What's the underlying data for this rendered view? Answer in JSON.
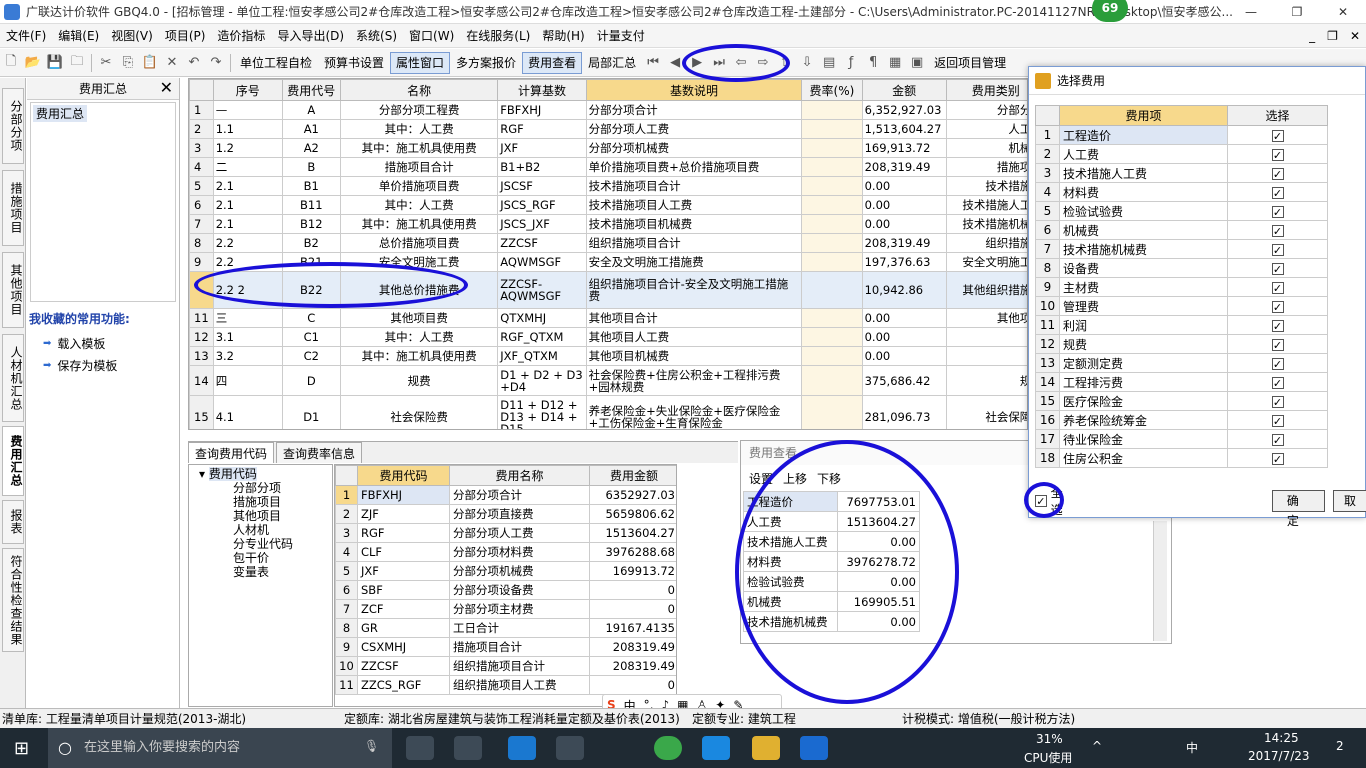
{
  "title_bar": {
    "text": "广联达计价软件 GBQ4.0 - [招标管理 - 单位工程:恒安孝感公司2#仓库改造工程>恒安孝感公司2#仓库改造工程>恒安孝感公司2#仓库改造工程-土建部分 - C:\\Users\\Administrator.PC-20141127NRH\\Desktop\\恒安孝感公...",
    "badge": "69",
    "minimize": "—",
    "maximize": "❐",
    "close": "✕"
  },
  "menu": [
    "文件(F)",
    "编辑(E)",
    "视图(V)",
    "项目(P)",
    "造价指标",
    "导入导出(D)",
    "系统(S)",
    "窗口(W)",
    "在线服务(L)",
    "帮助(H)",
    "计量支付"
  ],
  "menu_right": [
    "_",
    "❐",
    "✕"
  ],
  "toolbar": {
    "self_check": "单位工程自检",
    "budget_setting": "预算书设置",
    "property_window": "属性窗口",
    "multi_quote": "多方案报价",
    "fee_view": "费用查看",
    "partial_summary": "局部汇总",
    "back_project": "返回项目管理"
  },
  "left_tabs": [
    "分部分项",
    "措施项目",
    "其他项目",
    "人材机汇总",
    "费用汇总",
    "报表",
    "符合性检查结果"
  ],
  "side_panel": {
    "title": "费用汇总",
    "close": "✕",
    "tree_node": "费用汇总",
    "fav_title": "我收藏的常用功能:",
    "fav_items": [
      "载入模板",
      "保存为模板"
    ]
  },
  "grid": {
    "headers": [
      "",
      "序号",
      "费用代号",
      "名称",
      "计算基数",
      "基数说明",
      "费率(%)",
      "金额",
      "费用类别",
      "不可"
    ],
    "rows": [
      [
        "1",
        "⊟",
        "—",
        "A",
        "分部分项工程费",
        "FBFXHJ",
        "分部分项合计",
        "",
        "6,352,927.03",
        "分部分项"
      ],
      [
        "2",
        "",
        "1.1",
        "A1",
        "其中：人工费",
        "RGF",
        "分部分项人工费",
        "",
        "1,513,604.27",
        "人工费"
      ],
      [
        "3",
        "",
        "1.2",
        "A2",
        "其中：施工机具使用费",
        "JXF",
        "分部分项机械费",
        "",
        "169,913.72",
        "机械费"
      ],
      [
        "4",
        "⊟",
        "二",
        "B",
        "措施项目合计",
        "B1+B2",
        "单价措施项目费+总价措施项目费",
        "",
        "208,319.49",
        "措施项目"
      ],
      [
        "5",
        "⊟",
        "2.1",
        "B1",
        "单价措施项目费",
        "JSCSF",
        "技术措施项目合计",
        "",
        "0.00",
        "技术措施费"
      ],
      [
        "6",
        "",
        "2.1",
        "B11",
        "其中：人工费",
        "JSCS_RGF",
        "技术措施项目人工费",
        "",
        "0.00",
        "技术措施人工费"
      ],
      [
        "7",
        "",
        "2.1",
        "B12",
        "其中：施工机具使用费",
        "JSCS_JXF",
        "技术措施项目机械费",
        "",
        "0.00",
        "技术措施机械费"
      ],
      [
        "8",
        "⊟",
        "2.2",
        "B2",
        "总价措施项目费",
        "ZZCSF",
        "组织措施项目合计",
        "",
        "208,319.49",
        "组织措施费"
      ],
      [
        "9",
        "",
        "2.2",
        "B21",
        "安全文明施工费",
        "AQWMSGF",
        "安全及文明施工措施费",
        "",
        "197,376.63",
        "安全文明施工费"
      ],
      [
        "",
        "",
        "2.2 2",
        "B22",
        "其他总价措施费",
        "ZZCSF-AQWMSGF",
        "组织措施项目合计-安全及文明施工措施费",
        "",
        "10,942.86",
        "其他组织措施费"
      ],
      [
        "11",
        "⊟",
        "三",
        "C",
        "其他项目费",
        "QTXMHJ",
        "其他项目合计",
        "",
        "0.00",
        "其他项目"
      ],
      [
        "12",
        "",
        "3.1",
        "C1",
        "其中：人工费",
        "RGF_QTXM",
        "其他项目人工费",
        "",
        "0.00",
        ""
      ],
      [
        "13",
        "",
        "3.2",
        "C2",
        "其中：施工机具使用费",
        "JXF_QTXM",
        "其他项目机械费",
        "",
        "0.00",
        ""
      ],
      [
        "14",
        "⊟",
        "四",
        "D",
        "规费",
        "D1 + D2 + D3 +D4",
        "社会保险费+住房公积金+工程排污费+园林规费",
        "",
        "375,686.42",
        "规费"
      ],
      [
        "15",
        "⊟",
        "4.1",
        "D1",
        "社会保险费",
        "D11 + D12 + D13 + D14 + D15",
        "养老保险金+失业保险金+医疗保险金+工伤保险金+生育保险金",
        "",
        "281,096.73",
        "社会保障费"
      ]
    ]
  },
  "bottom_tabs": [
    "查询费用代码",
    "查询费率信息"
  ],
  "code_tree": {
    "root": "费用代码",
    "children": [
      "分部分项",
      "措施项目",
      "其他项目",
      "人材机",
      "分专业代码",
      "包干价",
      "变量表"
    ]
  },
  "code_grid": {
    "headers": [
      "",
      "费用代码",
      "费用名称",
      "费用金额"
    ],
    "rows": [
      [
        "1",
        "FBFXHJ",
        "分部分项合计",
        "6352927.03"
      ],
      [
        "2",
        "ZJF",
        "分部分项直接费",
        "5659806.62"
      ],
      [
        "3",
        "RGF",
        "分部分项人工费",
        "1513604.27"
      ],
      [
        "4",
        "CLF",
        "分部分项材料费",
        "3976288.68"
      ],
      [
        "5",
        "JXF",
        "分部分项机械费",
        "169913.72"
      ],
      [
        "6",
        "SBF",
        "分部分项设备费",
        "0"
      ],
      [
        "7",
        "ZCF",
        "分部分项主材费",
        "0"
      ],
      [
        "8",
        "GR",
        "工日合计",
        "19167.4135"
      ],
      [
        "9",
        "CSXMHJ",
        "措施项目合计",
        "208319.49"
      ],
      [
        "10",
        "ZZCSF",
        "组织措施项目合计",
        "208319.49"
      ],
      [
        "11",
        "ZZCS_RGF",
        "组织措施项目人工费",
        "0"
      ]
    ]
  },
  "fee_view": {
    "caption": "费用查看",
    "actions": [
      "设置",
      "上移",
      "下移"
    ],
    "rows": [
      [
        "工程造价",
        "7697753.01"
      ],
      [
        "人工费",
        "1513604.27"
      ],
      [
        "技术措施人工费",
        "0.00"
      ],
      [
        "材料费",
        "3976278.72"
      ],
      [
        "检验试验费",
        "0.00"
      ],
      [
        "机械费",
        "169905.51"
      ],
      [
        "技术措施机械费",
        "0.00"
      ]
    ]
  },
  "dialog": {
    "title": "选择费用",
    "headers": [
      "",
      "费用项",
      "选择"
    ],
    "rows": [
      [
        "1",
        "工程造价"
      ],
      [
        "2",
        "人工费"
      ],
      [
        "3",
        "技术措施人工费"
      ],
      [
        "4",
        "材料费"
      ],
      [
        "5",
        "检验试验费"
      ],
      [
        "6",
        "机械费"
      ],
      [
        "7",
        "技术措施机械费"
      ],
      [
        "8",
        "设备费"
      ],
      [
        "9",
        "主材费"
      ],
      [
        "10",
        "管理费"
      ],
      [
        "11",
        "利润"
      ],
      [
        "12",
        "规费"
      ],
      [
        "13",
        "定额测定费"
      ],
      [
        "14",
        "工程排污费"
      ],
      [
        "15",
        "医疗保险金"
      ],
      [
        "16",
        "养老保险统筹金"
      ],
      [
        "17",
        "待业保险金"
      ],
      [
        "18",
        "住房公积金"
      ]
    ],
    "check": "✓",
    "select_all": "全选",
    "ok": "确定",
    "cancel": "取"
  },
  "status": {
    "list_lib": "清单库:  工程量清单项目计量规范(2013-湖北)",
    "quota_lib": "定额库:  湖北省房屋建筑与装饰工程消耗量定额及基价表(2013)",
    "specialty": "定额专业:  建筑工程",
    "tax_mode": "计税模式:  增值税(一般计税方法)"
  },
  "ime": [
    "S",
    "中",
    "°,",
    "♪",
    "▦",
    "♙",
    "✦",
    "✎"
  ],
  "taskbar": {
    "search_placeholder": "在这里输入你要搜索的内容",
    "cpu": "31%",
    "cpu_label": "CPU使用",
    "lang": "中",
    "time": "14:25",
    "date": "2017/7/23",
    "notif": "2"
  }
}
